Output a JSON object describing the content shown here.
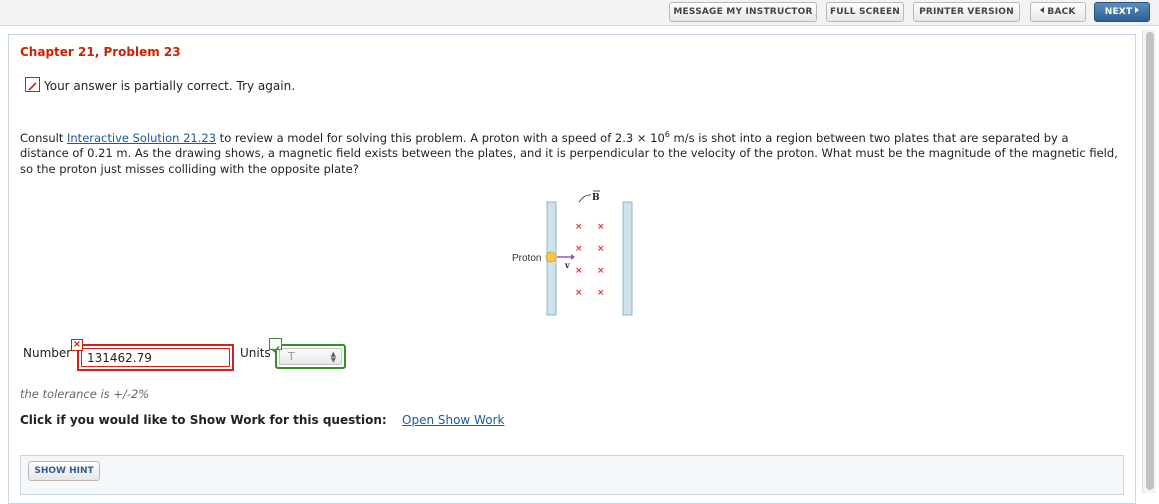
{
  "toolbar": {
    "message_instructor": "MESSAGE MY INSTRUCTOR",
    "full_screen": "FULL SCREEN",
    "printer_version": "PRINTER VERSION",
    "back": "BACK",
    "next": "NEXT"
  },
  "problem": {
    "title": "Chapter 21, Problem 23",
    "status": "Your answer is partially correct.  Try again.",
    "text_before_link": "Consult ",
    "link_text": "Interactive Solution 21.23",
    "text_mid": " to review a model for solving this problem. A proton with a speed of 2.3 × 10",
    "speed_exponent": "6",
    "text_after": " m/s is shot into a region between two plates that are separated by a distance of 0.21 m. As the drawing shows, a magnetic field exists between the plates, and it is perpendicular to the velocity of the proton. What must be the magnitude of the magnetic field, so the proton just misses colliding with the opposite plate?"
  },
  "figure": {
    "proton_label": "Proton",
    "field_label": "B",
    "velocity_label": "v",
    "colors": {
      "plate": "#cfe3ea",
      "plate_border": "#8fb3c4",
      "field_x": "#e2323a",
      "proton": "#f5c84a",
      "velocity_arrow": "#8a5ab5"
    }
  },
  "answer": {
    "number_label": "Number",
    "number_value": "131462.79",
    "number_status_icon": "x-icon",
    "units_label": "Units",
    "units_value": "T",
    "units_status_icon": "check-icon"
  },
  "tolerance": "the tolerance is +/-2%",
  "show_work": {
    "label": "Click if you would like to Show Work for this question:",
    "link": "Open Show Work"
  },
  "hint": {
    "button": "SHOW HINT"
  }
}
